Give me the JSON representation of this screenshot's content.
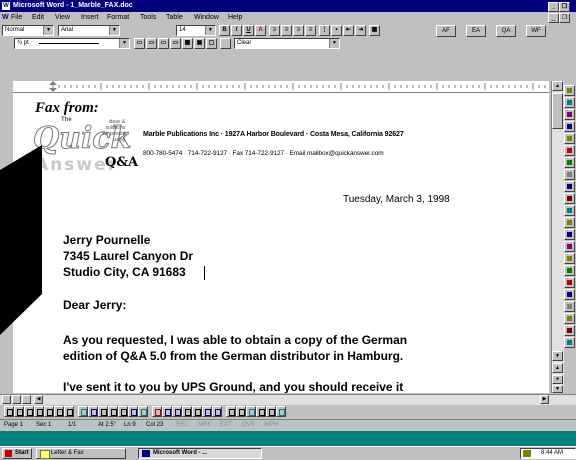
{
  "window": {
    "title": "Microsoft Word - 1_Marble_FAX.doc",
    "app_icon": "W",
    "minimize_label": "_",
    "restore_label": "❐",
    "close_label": "✕"
  },
  "menu": {
    "doc_icon": "W",
    "items": [
      "File",
      "Edit",
      "View",
      "Insert",
      "Format",
      "Tools",
      "Table",
      "Window",
      "Help"
    ]
  },
  "formatting": {
    "style": "Normal",
    "font": "Arial",
    "size": "14",
    "bold": "B",
    "italic": "I",
    "underline": "U",
    "highlight": "A",
    "macro_buttons": [
      "AF",
      "EA",
      "QA",
      "WF"
    ]
  },
  "borders": {
    "line_weight": "¾ pt",
    "shading": "Clear"
  },
  "document": {
    "fax_from": "Fax from:",
    "logo": {
      "the": "The",
      "quick": "Quick",
      "answer": "Answer",
      "tagline": [
        "ideas &",
        "solutions",
        "for people",
        "using"
      ],
      "qa_mark": "Q&A"
    },
    "company_line": "Marble Publications Inc · 1927A Harbor Boulevard · Costa Mesa, California 92627",
    "contact_line": "800-780-5474 · 714-722-9127 · Fax 714-722-9127 · Email mailbox@quickanswer.com",
    "date": "Tuesday, March 3, 1998",
    "address": [
      "Jerry Pournelle",
      "7345 Laurel Canyon Dr",
      "Studio City, CA 91683"
    ],
    "salutation": "Dear Jerry:",
    "paragraph1": [
      "As you requested, I was able to obtain a copy of the German",
      "edition of Q&A 5.0 from the German distributor in Hamburg."
    ],
    "paragraph2": "I've sent it to you by UPS Ground, and you should receive it"
  },
  "status": {
    "page": "Page 1",
    "sec": "Sec 1",
    "pages": "1/1",
    "at": "At 2.5\"",
    "ln": "Ln 9",
    "col": "Col 23",
    "modes": [
      "REC",
      "MRK",
      "EXT",
      "OVR",
      "WPH"
    ]
  },
  "taskbar": {
    "start": "Start",
    "tasks": [
      "Letter & Fax",
      "Microsoft Word - ..."
    ],
    "clock": "8:44 AM"
  },
  "colors": {
    "titlebar": "#000080",
    "face": "#c0c0c0"
  }
}
